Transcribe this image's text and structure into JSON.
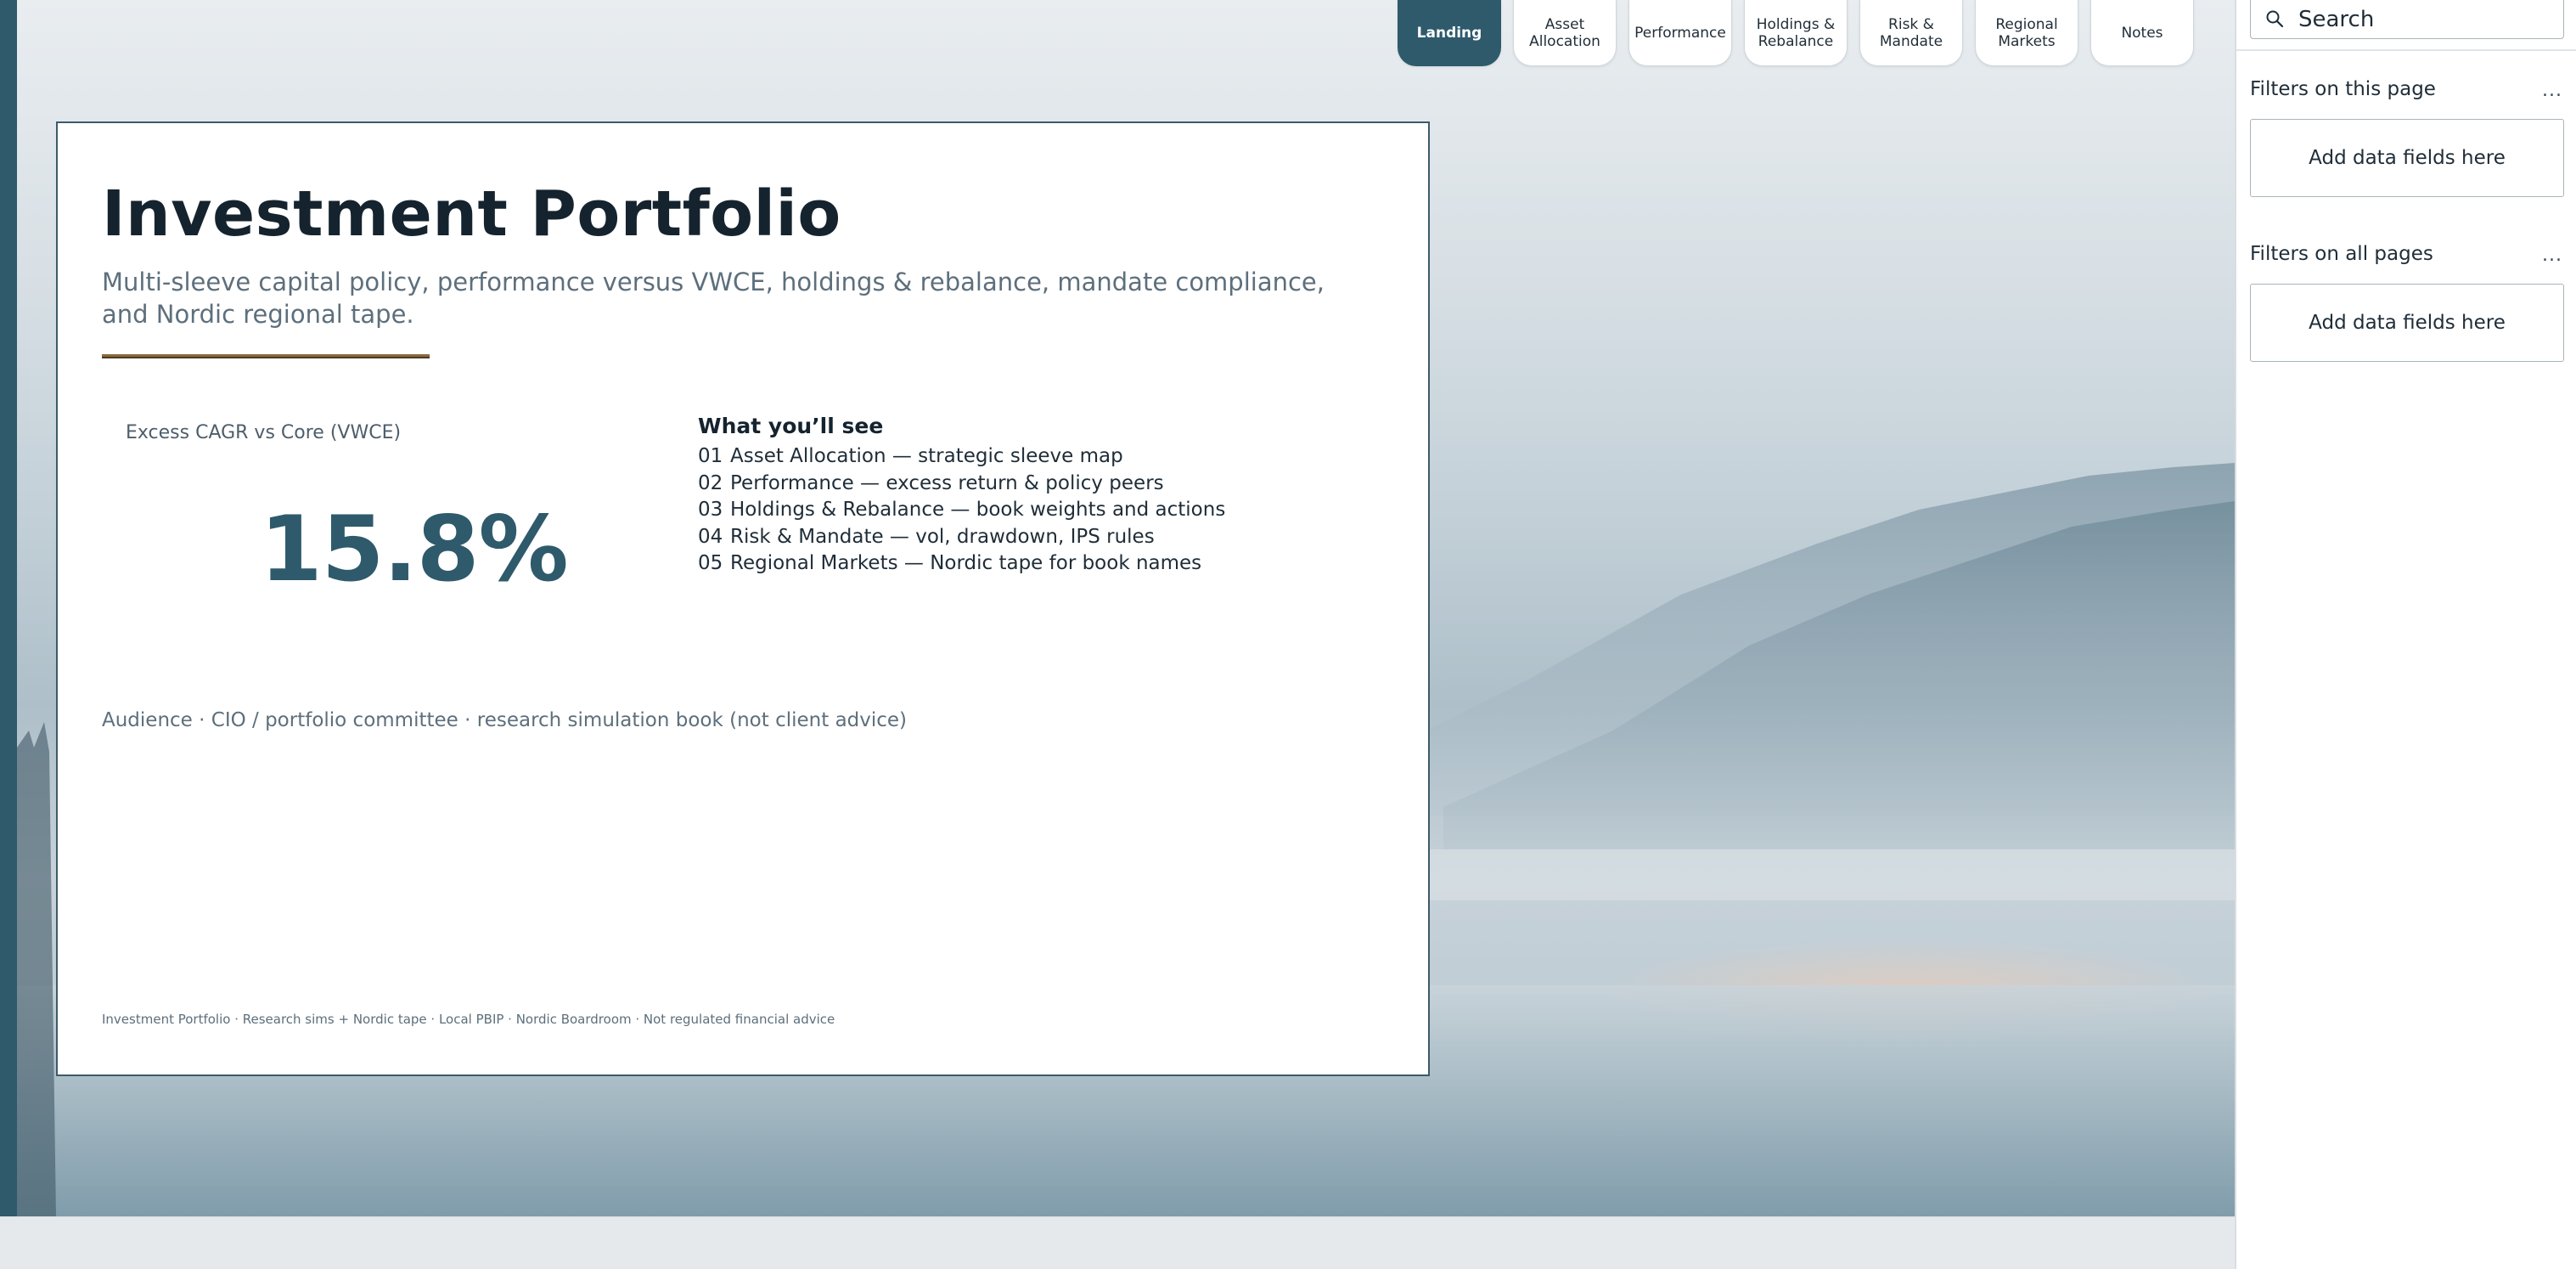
{
  "nav": {
    "tabs": [
      {
        "label": "Landing",
        "active": true
      },
      {
        "label": "Asset\nAllocation",
        "active": false
      },
      {
        "label": "Performance",
        "active": false
      },
      {
        "label": "Holdings &\nRebalance",
        "active": false
      },
      {
        "label": "Risk &\nMandate",
        "active": false
      },
      {
        "label": "Regional\nMarkets",
        "active": false
      },
      {
        "label": "Notes",
        "active": false
      }
    ]
  },
  "card": {
    "title": "Investment Portfolio",
    "subtitle": "Multi-sleeve capital policy, performance versus VWCE, holdings & rebalance, mandate compliance, and Nordic regional tape.",
    "kpi": {
      "label": "Excess CAGR vs Core (VWCE)",
      "value": "15.8%"
    },
    "what_youll_see": {
      "heading": "What you’ll see",
      "items": [
        {
          "num": "01",
          "text": "Asset Allocation — strategic sleeve map"
        },
        {
          "num": "02",
          "text": "Performance — excess return & policy peers"
        },
        {
          "num": "03",
          "text": "Holdings & Rebalance — book weights and actions"
        },
        {
          "num": "04",
          "text": "Risk & Mandate — vol, drawdown, IPS rules"
        },
        {
          "num": "05",
          "text": "Regional Markets — Nordic tape for book names"
        }
      ]
    },
    "audience": "Audience · CIO / portfolio committee · research simulation book (not client advice)",
    "footer": "Investment Portfolio · Research sims + Nordic tape · Local PBIP · Nordic Boardroom · Not regulated financial advice"
  },
  "filters_pane": {
    "search_placeholder": "Search",
    "this_page": {
      "title": "Filters on this page",
      "more": "...",
      "drop_label": "Add data fields here"
    },
    "all_pages": {
      "title": "Filters on all pages",
      "more": "...",
      "drop_label": "Add data fields here"
    }
  },
  "colors": {
    "accent": "#2e5a6c",
    "rule": "#8a6a3e",
    "text_muted": "#5d6f7c"
  }
}
